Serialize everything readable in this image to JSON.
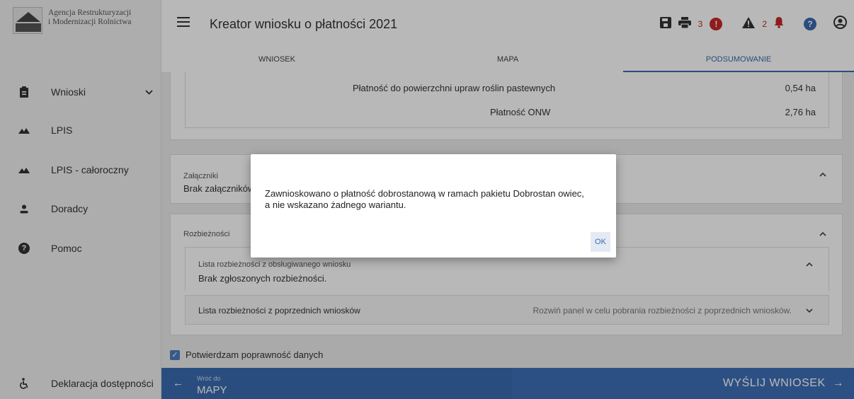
{
  "brand": {
    "line1": "Agencja Restrukturyzacji",
    "line2": "i Modernizacji Rolnictwa"
  },
  "sidebar": {
    "items": [
      {
        "label": "Wnioski",
        "icon": "clipboard-icon"
      },
      {
        "label": "LPIS",
        "icon": "mountain-icon"
      },
      {
        "label": "LPIS - całoroczny",
        "icon": "mountain-icon"
      },
      {
        "label": "Doradcy",
        "icon": "person-icon"
      },
      {
        "label": "Pomoc",
        "icon": "help-icon"
      }
    ],
    "footer": {
      "label": "Deklaracja dostępności",
      "icon": "accessibility-icon"
    }
  },
  "header": {
    "title": "Kreator wniosku o płatności 2021",
    "error_count": "3",
    "warning_count": "2"
  },
  "tabs": [
    {
      "label": "WNIOSEK"
    },
    {
      "label": "MAPA"
    },
    {
      "label": "PODSUMOWANIE"
    }
  ],
  "summary_rows": [
    {
      "label": "Płatność do powierzchni upraw roślin pastewnych",
      "value": "0,54 ha"
    },
    {
      "label": "Płatność ONW",
      "value": "2,76 ha"
    }
  ],
  "attachments": {
    "title": "Załączniki",
    "body": "Brak załączników"
  },
  "discrepancies": {
    "title": "Rozbieżności",
    "current": {
      "title": "Lista rozbieżności z obsługiwanego wniosku",
      "body": "Brak zgłoszonych rozbieżności."
    },
    "previous": {
      "title": "Lista rozbieżności z poprzednich wniosków",
      "hint": "Rozwiń panel w celu pobrania rozbieżności z poprzednich wniosków."
    }
  },
  "confirm": {
    "label": "Potwierdzam poprawność danych",
    "checked": true
  },
  "bottom": {
    "back_small": "Wróć do",
    "back_big": "MAPY",
    "send": "WYŚLIJ WNIOSEK"
  },
  "dialog": {
    "message": "Zawnioskowano o płatność dobrostanową w ramach pakietu Dobrostan owiec, a nie wskazano żadnego wariantu.",
    "ok_label": "OK"
  },
  "colors": {
    "accent": "#3b6bb0",
    "error": "#c62828",
    "help": "#3b6bb0"
  }
}
